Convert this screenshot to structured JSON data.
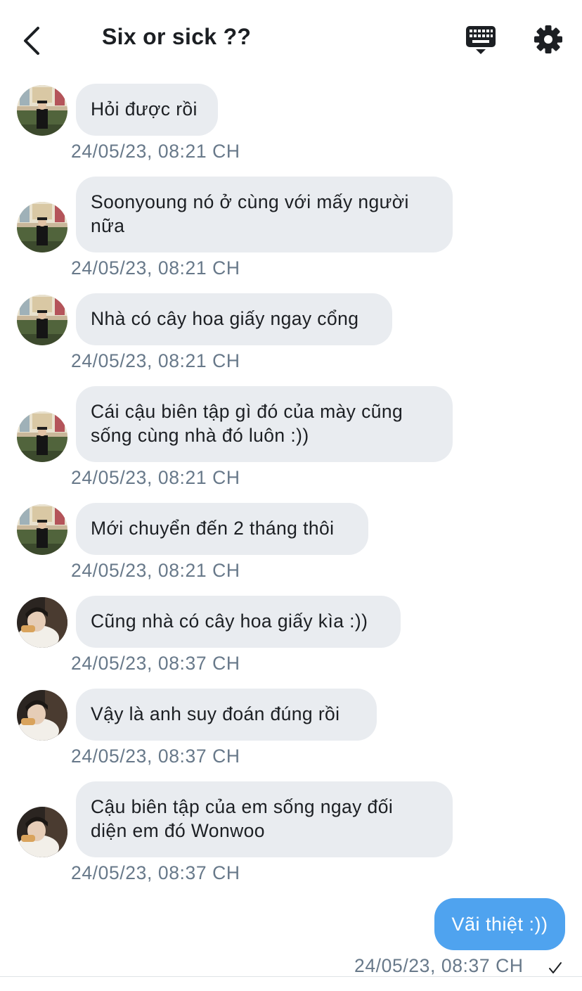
{
  "header": {
    "title": "Six or sick ??"
  },
  "messages": [
    {
      "lines": [
        "Hỏi được rồi"
      ],
      "time": "24/05/23, 08:21 CH",
      "avatar": "a"
    },
    {
      "lines": [
        "Soonyoung nó ở cùng với mấy người",
        "nữa"
      ],
      "time": "24/05/23, 08:21 CH",
      "avatar": "a"
    },
    {
      "lines": [
        "Nhà có cây hoa giấy ngay cổng"
      ],
      "time": "24/05/23, 08:21 CH",
      "avatar": "a"
    },
    {
      "lines": [
        "Cái cậu biên tập gì đó của mày cũng",
        "sống cùng nhà đó luôn :))"
      ],
      "time": "24/05/23, 08:21 CH",
      "avatar": "a"
    },
    {
      "lines": [
        "Mới chuyển đến 2 tháng thôi"
      ],
      "time": "24/05/23, 08:21 CH",
      "avatar": "a"
    },
    {
      "lines": [
        "Cũng nhà có cây hoa giấy kìa :))"
      ],
      "time": "24/05/23, 08:37 CH",
      "avatar": "b"
    },
    {
      "lines": [
        "Vậy là anh suy đoán đúng rồi"
      ],
      "time": "24/05/23, 08:37 CH",
      "avatar": "b"
    },
    {
      "lines": [
        "Cậu biên tập của em sống ngay đối",
        "diện em đó Wonwoo"
      ],
      "time": "24/05/23, 08:37 CH",
      "avatar": "b"
    }
  ],
  "sent": {
    "text": "Vãi thiệt :))",
    "time": "24/05/23, 08:37 CH"
  },
  "colors": {
    "sent_bubble": "#4fa3ef",
    "received_bubble": "#e9ecf0",
    "timestamp": "#68798a"
  },
  "icons": {
    "back": "chevron-left-icon",
    "keyboard": "keyboard-icon",
    "settings": "gear-icon",
    "read": "checkmark-icon"
  }
}
